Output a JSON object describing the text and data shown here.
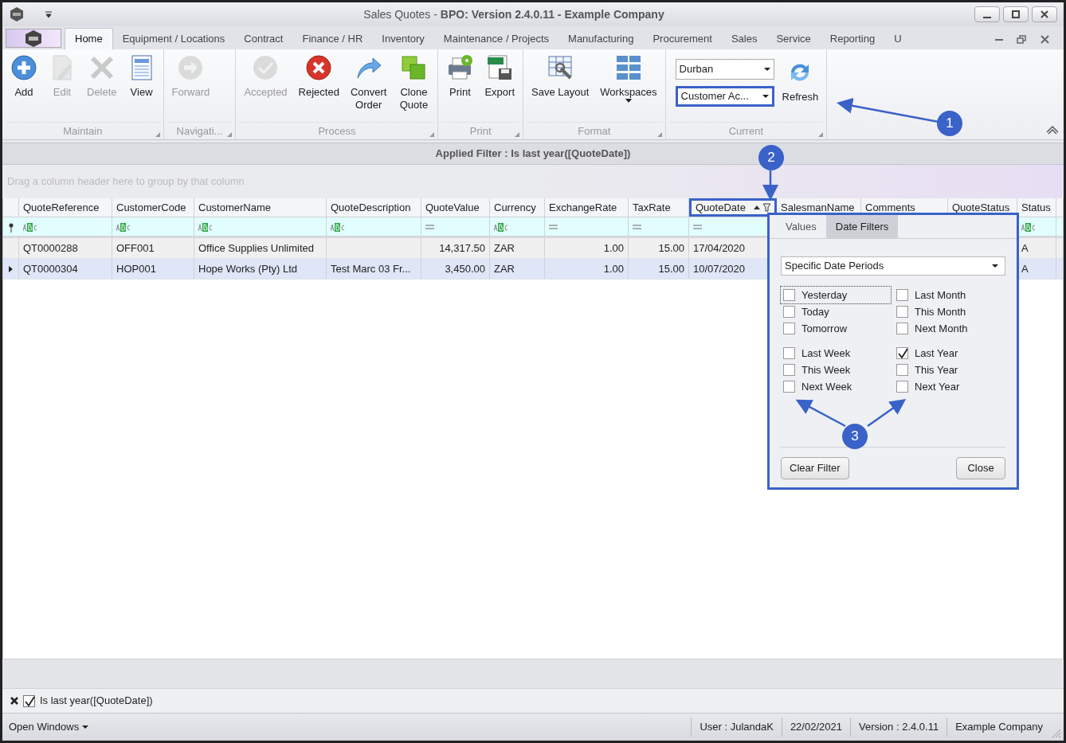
{
  "window": {
    "title": "Sales Quotes - **BPO: Version 2.4.0.11 - Example Company**"
  },
  "menu_tabs": [
    {
      "label": "Home",
      "selected": true
    },
    {
      "label": "Equipment / Locations",
      "selected": false
    },
    {
      "label": "Contract",
      "selected": false
    },
    {
      "label": "Finance / HR",
      "selected": false
    },
    {
      "label": "Inventory",
      "selected": false
    },
    {
      "label": "Maintenance / Projects",
      "selected": false
    },
    {
      "label": "Manufacturing",
      "selected": false
    },
    {
      "label": "Procurement",
      "selected": false
    },
    {
      "label": "Sales",
      "selected": false
    },
    {
      "label": "Service",
      "selected": false
    },
    {
      "label": "Reporting",
      "selected": false
    },
    {
      "label": "U",
      "selected": false
    }
  ],
  "ribbon_groups": [
    {
      "label": "Maintain",
      "buttons": [
        {
          "label": "Add",
          "disabled": false
        },
        {
          "label": "Edit",
          "disabled": true
        },
        {
          "label": "Delete",
          "disabled": true
        },
        {
          "label": "View",
          "disabled": false
        }
      ]
    },
    {
      "label": "Navigati...",
      "buttons": [
        {
          "label": "Forward",
          "disabled": true
        }
      ]
    },
    {
      "label": "Process",
      "buttons": [
        {
          "label": "Accepted",
          "disabled": true
        },
        {
          "label": "Rejected",
          "disabled": false
        },
        {
          "label": "Convert Order",
          "disabled": false,
          "two_line": true
        },
        {
          "label": "Clone Quote",
          "disabled": false,
          "two_line": true
        }
      ]
    },
    {
      "label": "Print",
      "buttons": [
        {
          "label": "Print",
          "disabled": false
        },
        {
          "label": "Export",
          "disabled": false
        }
      ]
    },
    {
      "label": "Format",
      "buttons": [
        {
          "label": "Save Layout",
          "disabled": false
        },
        {
          "label": "Workspaces",
          "disabled": false,
          "dropdown": true
        }
      ]
    },
    {
      "label": "Current",
      "dropdowns": [
        {
          "value": "Durban",
          "highlighted": false
        },
        {
          "value": "Customer Ac...",
          "highlighted": true
        }
      ],
      "buttons": [
        {
          "label": "Refresh",
          "disabled": false
        }
      ]
    }
  ],
  "applied_filter": "Applied Filter : Is last year([QuoteDate])",
  "group_panel_hint": "Drag a column header here to group by that column",
  "grid": {
    "columns": [
      {
        "label": "QuoteReference",
        "kind": "text",
        "highlighted": false
      },
      {
        "label": "CustomerCode",
        "kind": "text",
        "highlighted": false
      },
      {
        "label": "CustomerName",
        "kind": "text",
        "highlighted": false
      },
      {
        "label": "QuoteDescription",
        "kind": "text",
        "highlighted": false
      },
      {
        "label": "QuoteValue",
        "kind": "number",
        "highlighted": false
      },
      {
        "label": "Currency",
        "kind": "text",
        "highlighted": false
      },
      {
        "label": "ExchangeRate",
        "kind": "number",
        "highlighted": false
      },
      {
        "label": "TaxRate",
        "kind": "number",
        "highlighted": false
      },
      {
        "label": "QuoteDate",
        "kind": "date",
        "highlighted": true,
        "sorted_ascending": true,
        "filtered": true
      },
      {
        "label": "SalesmanName",
        "highlighted": false
      },
      {
        "label": "Comments",
        "highlighted": false
      },
      {
        "label": "QuoteStatus",
        "highlighted": false
      },
      {
        "label": "Status",
        "kind": "text",
        "highlighted": false
      }
    ],
    "rows": [
      {
        "selected": false,
        "cells": [
          "QT0000288",
          "OFF001",
          "Office Supplies Unlimited",
          "",
          "14,317.50",
          "ZAR",
          "1.00",
          "15.00",
          "17/04/2020",
          "",
          "",
          "",
          "A"
        ]
      },
      {
        "selected": true,
        "cells": [
          "QT0000304",
          "HOP001",
          "Hope Works (Pty) Ltd",
          "Test Marc 03 Fr...",
          "3,450.00",
          "ZAR",
          "1.00",
          "15.00",
          "10/07/2020",
          "",
          "",
          "",
          "A"
        ]
      }
    ]
  },
  "filter_popup": {
    "tabs": [
      {
        "label": "Values",
        "selected": false
      },
      {
        "label": "Date Filters",
        "selected": true
      }
    ],
    "mode": "Specific Date Periods",
    "periods": [
      {
        "label": "Yesterday",
        "checked": false,
        "focused": true
      },
      {
        "label": "Today",
        "checked": false,
        "focused": false
      },
      {
        "label": "Tomorrow",
        "checked": false,
        "focused": false
      },
      {
        "label": "Last Week",
        "checked": false,
        "focused": false
      },
      {
        "label": "This Week",
        "checked": false,
        "focused": false
      },
      {
        "label": "Next Week",
        "checked": false,
        "focused": false
      },
      {
        "label": "Last Month",
        "checked": false,
        "focused": false
      },
      {
        "label": "This Month",
        "checked": false,
        "focused": false
      },
      {
        "label": "Next Month",
        "checked": false,
        "focused": false
      },
      {
        "label": "Last Year",
        "checked": true,
        "focused": false
      },
      {
        "label": "This Year",
        "checked": false,
        "focused": false
      },
      {
        "label": "Next Year",
        "checked": false,
        "focused": false
      }
    ],
    "buttons": [
      "Clear Filter",
      "Close"
    ]
  },
  "filter_footer": {
    "enabled": true,
    "text": "Is last year([QuoteDate])"
  },
  "status_bar": {
    "open_windows": "Open Windows",
    "fields": [
      "User : JulandaK",
      "22/02/2021",
      "Version : 2.4.0.11",
      "Example Company"
    ]
  },
  "annotations": [
    "1",
    "2",
    "3"
  ]
}
